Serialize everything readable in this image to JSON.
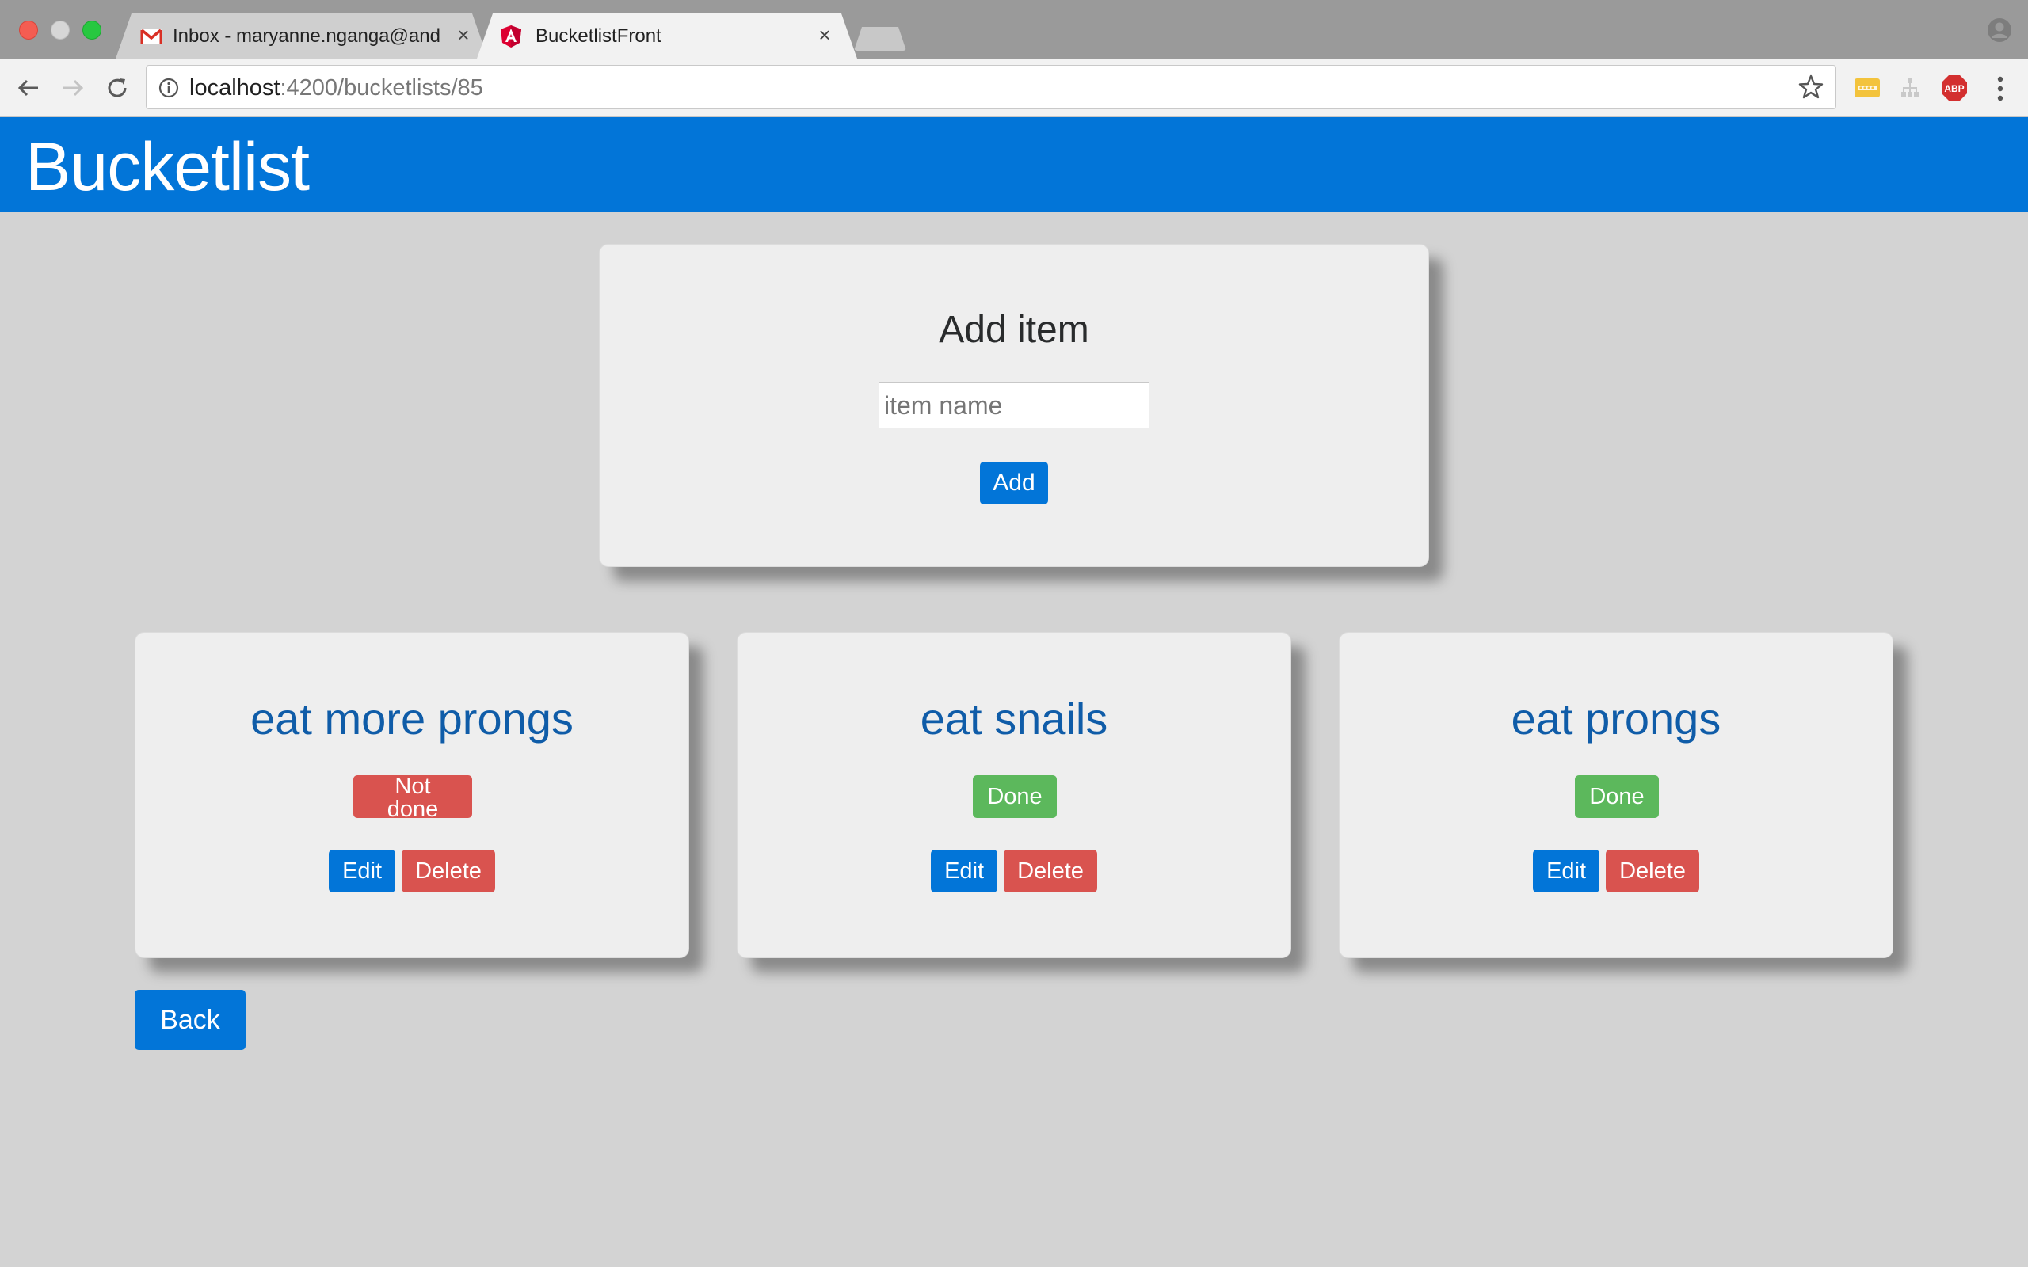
{
  "browser": {
    "tabs": [
      {
        "label": "Inbox - maryanne.nganga@and",
        "icon": "gmail-icon",
        "active": false
      },
      {
        "label": "BucketlistFront",
        "icon": "angular-icon",
        "active": true
      }
    ],
    "tab_close_glyph": "×",
    "address": {
      "host": "localhost",
      "path": ":4200/bucketlists/85"
    },
    "extensions": [
      "password-manager-icon",
      "tree-extension-icon",
      "adblock-icon"
    ],
    "adblock_label": "ABP"
  },
  "header": {
    "title": "Bucketlist"
  },
  "add_item": {
    "heading": "Add item",
    "placeholder": "item name",
    "value": "",
    "button_label": "Add"
  },
  "items": [
    {
      "name": "eat more prongs",
      "status": "Not done",
      "done": false,
      "edit_label": "Edit",
      "delete_label": "Delete"
    },
    {
      "name": "eat snails",
      "status": "Done",
      "done": true,
      "edit_label": "Edit",
      "delete_label": "Delete"
    },
    {
      "name": "eat prongs",
      "status": "Done",
      "done": true,
      "edit_label": "Edit",
      "delete_label": "Delete"
    }
  ],
  "back_label": "Back",
  "colors": {
    "primary": "#0275d8",
    "danger": "#d9534f",
    "success": "#5cb85c",
    "background": "#d3d3d3",
    "card": "#eeeeee"
  }
}
